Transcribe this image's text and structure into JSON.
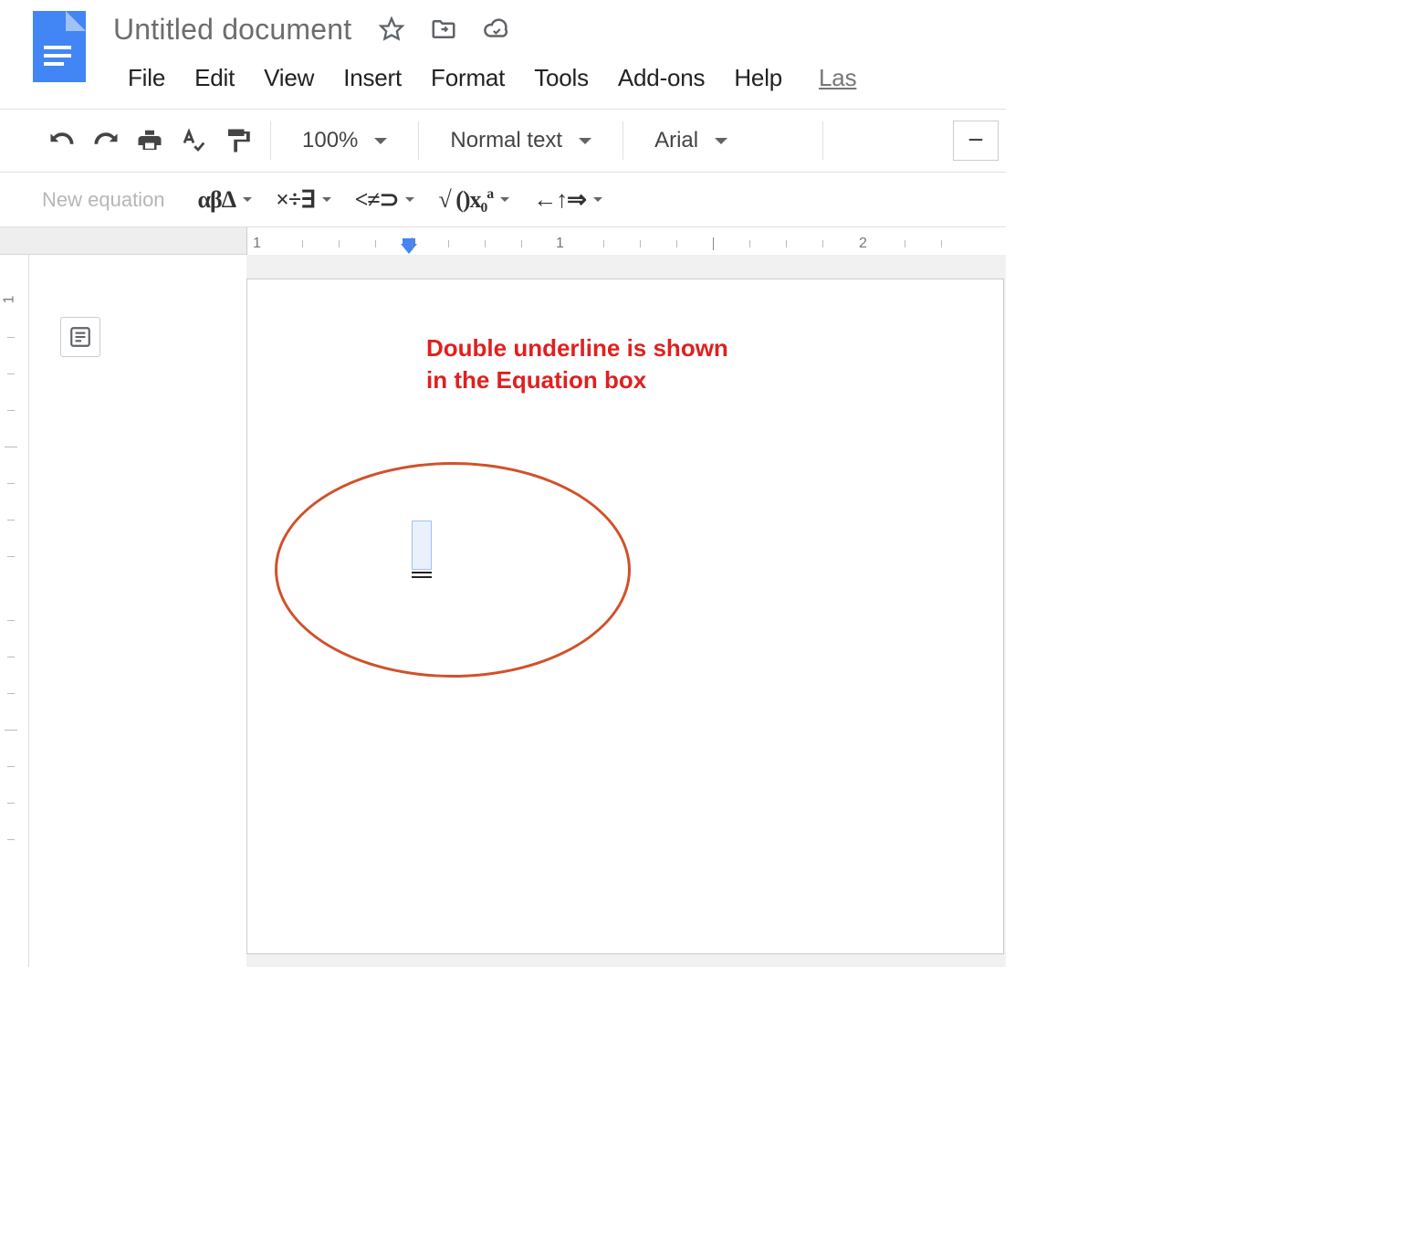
{
  "doc": {
    "title": "Untitled document"
  },
  "menus": {
    "file": "File",
    "edit": "Edit",
    "view": "View",
    "insert": "Insert",
    "format": "Format",
    "tools": "Tools",
    "addons": "Add-ons",
    "help": "Help",
    "last": "Las"
  },
  "toolbar": {
    "zoom": "100%",
    "style": "Normal text",
    "font": "Arial"
  },
  "eqbar": {
    "new_eq": "New equation",
    "greek": "αβΔ",
    "ops": "×÷∃",
    "rel": "<≠⊃",
    "math": "√ ()x₀ª",
    "arrows": "←↑⇒"
  },
  "ruler": {
    "n1": "1",
    "n2": "1",
    "n3": "2"
  },
  "vruler": {
    "n1": "1"
  },
  "annotation_text": "Double underline is shown in the Equation box"
}
